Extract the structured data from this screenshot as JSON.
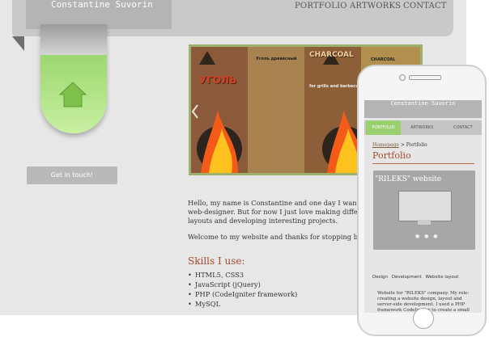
{
  "site": {
    "name": "Constantine Suvorin"
  },
  "nav": {
    "portfolio": "PORTFOLIO",
    "artworks": "ARTWORKS",
    "contact": "CONTACT"
  },
  "cta": {
    "label": "Get in touch!"
  },
  "slider": {
    "left_title": "УГОЛЬ",
    "right_title": "CHARCOAL",
    "right_caption": "for grills and barbecue",
    "left_small": "Уголь древесный",
    "right_small": "CHARCOAL"
  },
  "main": {
    "welcome_text": "Hello, my name is Constantine and one day I want to be web-designer. But for now I just love making different layouts and developing interesting projects.",
    "welcome_more": "Welcome to my website and thanks for stopping by!",
    "skills_title": "Skills I use:",
    "skills": [
      "HTML5, CSS3",
      "JavaScript (jQuery)",
      "PHP (CodeIgniter framework)",
      "MySQL"
    ]
  },
  "mobile": {
    "name": "Constantine Suvorin",
    "nav": {
      "portfolio": "PORTFOLIO",
      "artworks": "ARTWORKS",
      "contact": "CONTACT"
    },
    "breadcrumb_home": "Homepage",
    "breadcrumb_sep": " > ",
    "breadcrumb_current": "Portfolio",
    "page_title": "Portfolio",
    "project_title": "\"RILEKS\" website",
    "tabs": [
      "Design",
      "Development",
      "Website layout"
    ],
    "description": "Website for \"RILEKS\" company. My role: creating a website design, layout and server-side development. I used a PHP framework CodeIgniter to create a small and simple CMS for editing price on the website, adding"
  },
  "colors": {
    "accent_green": "#9ad06f",
    "accent_brown": "#a04a2b",
    "topbar_gray": "#c9c9c9"
  },
  "icons": {
    "home": "home-icon"
  }
}
